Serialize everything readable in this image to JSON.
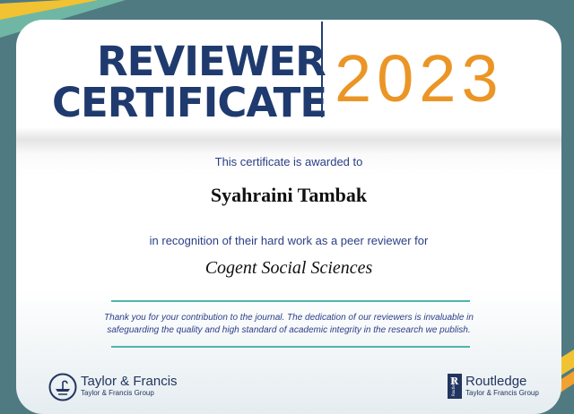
{
  "certificate": {
    "title_line1": "REVIEWER",
    "title_line2": "CERTIFICATE",
    "year": "2023",
    "awarded_text": "This certificate is awarded to",
    "recipient_name": "Syahraini Tambak",
    "recognition_text": "in recognition of their hard work as a peer reviewer for",
    "journal_name": "Cogent Social Sciences",
    "thanks_line1": "Thank you for your contribution to the journal. The dedication of our reviewers is invaluable in",
    "thanks_line2": "safeguarding the quality and high standard of academic integrity in the research we publish."
  },
  "logos": {
    "left_name": "Taylor & Francis",
    "left_sub": "Taylor & Francis Group",
    "right_name": "Routledge",
    "right_sub": "Taylor & Francis Group",
    "right_vertical_text": "Routledge",
    "left_icon": "lamp-icon",
    "right_icon": "routledge-r-icon"
  },
  "colors": {
    "background": "#4f7a82",
    "title_navy": "#1f3a6e",
    "year_orange": "#eb9526",
    "rule_teal": "#4fb5ad",
    "text_blue": "#2a3f86"
  }
}
